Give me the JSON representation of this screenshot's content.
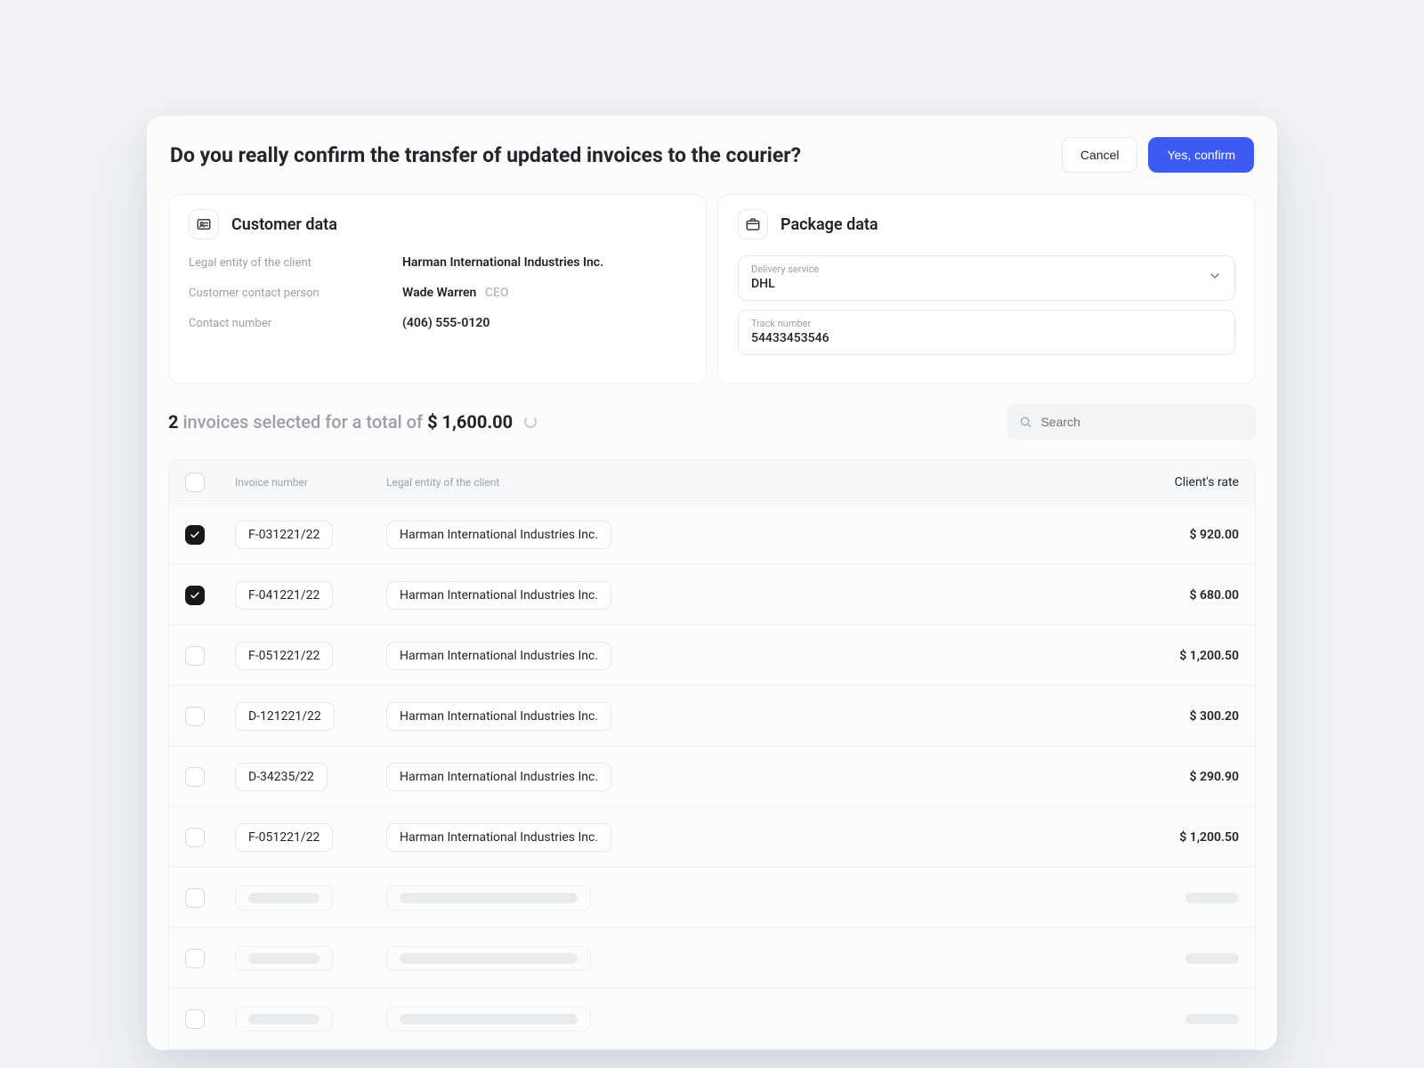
{
  "header": {
    "title": "Do you really confirm the transfer of updated invoices to the courier?",
    "cancel": "Cancel",
    "confirm": "Yes, confirm"
  },
  "customer": {
    "title": "Customer data",
    "legal_label": "Legal entity of the client",
    "legal_value": "Harman International Industries Inc.",
    "contact_person_label": "Customer contact person",
    "contact_person_value": "Wade Warren",
    "contact_person_role": "CEO",
    "contact_number_label": "Contact number",
    "contact_number_value": "(406) 555-0120"
  },
  "package": {
    "title": "Package data",
    "delivery_label": "Delivery service",
    "delivery_value": "DHL",
    "track_label": "Track number",
    "track_value": "54433453546"
  },
  "summary": {
    "count": "2",
    "mid": " invoices selected for a total of ",
    "total": "$ 1,600.00"
  },
  "search": {
    "placeholder": "Search"
  },
  "table": {
    "head_invoice": "Invoice number",
    "head_entity": "Legal entity of the client",
    "head_rate": "Client's rate",
    "rows": [
      {
        "checked": true,
        "inv": "F-031221/22",
        "entity": "Harman International Industries Inc.",
        "rate": "$ 920.00"
      },
      {
        "checked": true,
        "inv": "F-041221/22",
        "entity": "Harman International Industries Inc.",
        "rate": "$ 680.00"
      },
      {
        "checked": false,
        "inv": "F-051221/22",
        "entity": "Harman International Industries Inc.",
        "rate": "$ 1,200.50"
      },
      {
        "checked": false,
        "inv": "D-121221/22",
        "entity": "Harman International Industries Inc.",
        "rate": "$ 300.20"
      },
      {
        "checked": false,
        "inv": "D-34235/22",
        "entity": "Harman International Industries Inc.",
        "rate": "$ 290.90"
      },
      {
        "checked": false,
        "inv": "F-051221/22",
        "entity": "Harman International Industries Inc.",
        "rate": "$ 1,200.50"
      }
    ]
  }
}
